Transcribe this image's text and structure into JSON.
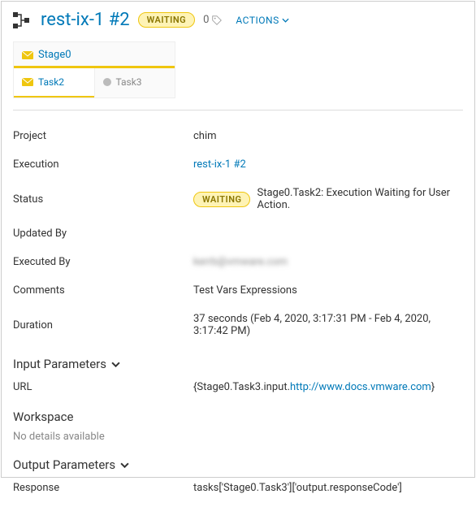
{
  "header": {
    "title": "rest-ix-1 #2",
    "status_badge": "WAITING",
    "tag_count": "0",
    "actions_label": "ACTIONS"
  },
  "stage": {
    "name": "Stage0",
    "tasks": [
      {
        "name": "Task2",
        "status": "waiting"
      },
      {
        "name": "Task3",
        "status": "pending"
      }
    ]
  },
  "details": {
    "project_label": "Project",
    "project_value": "chim",
    "execution_label": "Execution",
    "execution_value": "rest-ix-1 #2",
    "status_label": "Status",
    "status_badge": "WAITING",
    "status_text": "Stage0.Task2: Execution Waiting for User Action.",
    "updated_by_label": "Updated By",
    "updated_by_value": "",
    "executed_by_label": "Executed By",
    "executed_by_value": "kerrb@vmware.com",
    "comments_label": "Comments",
    "comments_value": "Test Vars Expressions",
    "duration_label": "Duration",
    "duration_value": "37 seconds (Feb 4, 2020, 3:17:31 PM - Feb 4, 2020, 3:17:42 PM)"
  },
  "input_params": {
    "header": "Input Parameters",
    "url_label": "URL",
    "url_prefix": "{Stage0.Task3.input.",
    "url_link": "http://www.docs.vmware.com",
    "url_suffix": "}"
  },
  "workspace": {
    "header": "Workspace",
    "no_details": "No details available"
  },
  "output_params": {
    "header": "Output Parameters",
    "response_label": "Response",
    "response_value": "tasks['Stage0.Task3']['output.responseCode']"
  }
}
